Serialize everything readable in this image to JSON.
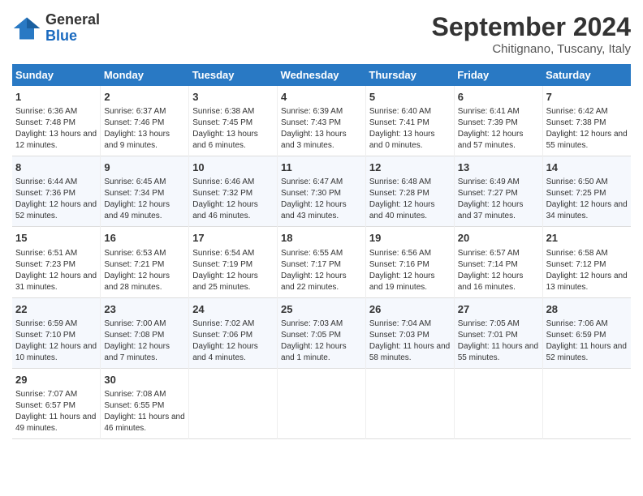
{
  "logo": {
    "general": "General",
    "blue": "Blue"
  },
  "header": {
    "month": "September 2024",
    "location": "Chitignano, Tuscany, Italy"
  },
  "days_of_week": [
    "Sunday",
    "Monday",
    "Tuesday",
    "Wednesday",
    "Thursday",
    "Friday",
    "Saturday"
  ],
  "weeks": [
    [
      {
        "day": "1",
        "info": "Sunrise: 6:36 AM\nSunset: 7:48 PM\nDaylight: 13 hours and 12 minutes."
      },
      {
        "day": "2",
        "info": "Sunrise: 6:37 AM\nSunset: 7:46 PM\nDaylight: 13 hours and 9 minutes."
      },
      {
        "day": "3",
        "info": "Sunrise: 6:38 AM\nSunset: 7:45 PM\nDaylight: 13 hours and 6 minutes."
      },
      {
        "day": "4",
        "info": "Sunrise: 6:39 AM\nSunset: 7:43 PM\nDaylight: 13 hours and 3 minutes."
      },
      {
        "day": "5",
        "info": "Sunrise: 6:40 AM\nSunset: 7:41 PM\nDaylight: 13 hours and 0 minutes."
      },
      {
        "day": "6",
        "info": "Sunrise: 6:41 AM\nSunset: 7:39 PM\nDaylight: 12 hours and 57 minutes."
      },
      {
        "day": "7",
        "info": "Sunrise: 6:42 AM\nSunset: 7:38 PM\nDaylight: 12 hours and 55 minutes."
      }
    ],
    [
      {
        "day": "8",
        "info": "Sunrise: 6:44 AM\nSunset: 7:36 PM\nDaylight: 12 hours and 52 minutes."
      },
      {
        "day": "9",
        "info": "Sunrise: 6:45 AM\nSunset: 7:34 PM\nDaylight: 12 hours and 49 minutes."
      },
      {
        "day": "10",
        "info": "Sunrise: 6:46 AM\nSunset: 7:32 PM\nDaylight: 12 hours and 46 minutes."
      },
      {
        "day": "11",
        "info": "Sunrise: 6:47 AM\nSunset: 7:30 PM\nDaylight: 12 hours and 43 minutes."
      },
      {
        "day": "12",
        "info": "Sunrise: 6:48 AM\nSunset: 7:28 PM\nDaylight: 12 hours and 40 minutes."
      },
      {
        "day": "13",
        "info": "Sunrise: 6:49 AM\nSunset: 7:27 PM\nDaylight: 12 hours and 37 minutes."
      },
      {
        "day": "14",
        "info": "Sunrise: 6:50 AM\nSunset: 7:25 PM\nDaylight: 12 hours and 34 minutes."
      }
    ],
    [
      {
        "day": "15",
        "info": "Sunrise: 6:51 AM\nSunset: 7:23 PM\nDaylight: 12 hours and 31 minutes."
      },
      {
        "day": "16",
        "info": "Sunrise: 6:53 AM\nSunset: 7:21 PM\nDaylight: 12 hours and 28 minutes."
      },
      {
        "day": "17",
        "info": "Sunrise: 6:54 AM\nSunset: 7:19 PM\nDaylight: 12 hours and 25 minutes."
      },
      {
        "day": "18",
        "info": "Sunrise: 6:55 AM\nSunset: 7:17 PM\nDaylight: 12 hours and 22 minutes."
      },
      {
        "day": "19",
        "info": "Sunrise: 6:56 AM\nSunset: 7:16 PM\nDaylight: 12 hours and 19 minutes."
      },
      {
        "day": "20",
        "info": "Sunrise: 6:57 AM\nSunset: 7:14 PM\nDaylight: 12 hours and 16 minutes."
      },
      {
        "day": "21",
        "info": "Sunrise: 6:58 AM\nSunset: 7:12 PM\nDaylight: 12 hours and 13 minutes."
      }
    ],
    [
      {
        "day": "22",
        "info": "Sunrise: 6:59 AM\nSunset: 7:10 PM\nDaylight: 12 hours and 10 minutes."
      },
      {
        "day": "23",
        "info": "Sunrise: 7:00 AM\nSunset: 7:08 PM\nDaylight: 12 hours and 7 minutes."
      },
      {
        "day": "24",
        "info": "Sunrise: 7:02 AM\nSunset: 7:06 PM\nDaylight: 12 hours and 4 minutes."
      },
      {
        "day": "25",
        "info": "Sunrise: 7:03 AM\nSunset: 7:05 PM\nDaylight: 12 hours and 1 minute."
      },
      {
        "day": "26",
        "info": "Sunrise: 7:04 AM\nSunset: 7:03 PM\nDaylight: 11 hours and 58 minutes."
      },
      {
        "day": "27",
        "info": "Sunrise: 7:05 AM\nSunset: 7:01 PM\nDaylight: 11 hours and 55 minutes."
      },
      {
        "day": "28",
        "info": "Sunrise: 7:06 AM\nSunset: 6:59 PM\nDaylight: 11 hours and 52 minutes."
      }
    ],
    [
      {
        "day": "29",
        "info": "Sunrise: 7:07 AM\nSunset: 6:57 PM\nDaylight: 11 hours and 49 minutes."
      },
      {
        "day": "30",
        "info": "Sunrise: 7:08 AM\nSunset: 6:55 PM\nDaylight: 11 hours and 46 minutes."
      },
      {
        "day": "",
        "info": ""
      },
      {
        "day": "",
        "info": ""
      },
      {
        "day": "",
        "info": ""
      },
      {
        "day": "",
        "info": ""
      },
      {
        "day": "",
        "info": ""
      }
    ]
  ]
}
